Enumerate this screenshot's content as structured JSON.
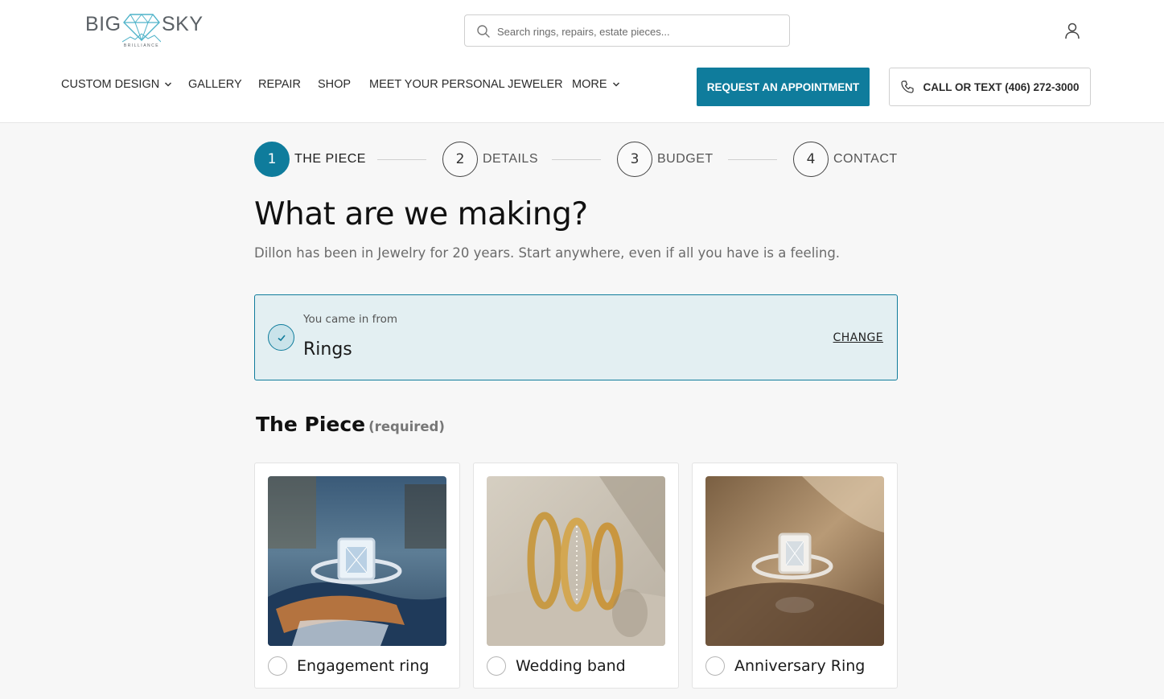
{
  "brand": {
    "left_word": "BIG",
    "right_word": "SKY",
    "tagline": "BRILLIANCE"
  },
  "search": {
    "placeholder": "Search rings, repairs, estate pieces..."
  },
  "nav": [
    {
      "label": "CUSTOM DESIGN",
      "has_dropdown": true
    },
    {
      "label": "GALLERY",
      "has_dropdown": false
    },
    {
      "label": "REPAIR",
      "has_dropdown": false
    },
    {
      "label": "SHOP",
      "has_dropdown": false
    },
    {
      "label": "MEET YOUR PERSONAL JEWELER",
      "has_dropdown": false
    },
    {
      "label": "MORE",
      "has_dropdown": true
    }
  ],
  "cta": {
    "appointment": "REQUEST AN APPOINTMENT",
    "call": "CALL OR TEXT (406) 272-3000"
  },
  "steps": [
    {
      "number": "1",
      "label": "THE PIECE",
      "active": true
    },
    {
      "number": "2",
      "label": "DETAILS",
      "active": false
    },
    {
      "number": "3",
      "label": "BUDGET",
      "active": false
    },
    {
      "number": "4",
      "label": "CONTACT",
      "active": false
    }
  ],
  "page": {
    "title": "What are we making?",
    "subtitle": "Dillon has been in Jewelry for 20 years. Start anywhere, even if all you have is a feeling."
  },
  "origin": {
    "label": "You came in from",
    "value": "Rings",
    "change": "CHANGE"
  },
  "section": {
    "title": "The Piece",
    "note": "(required)"
  },
  "options": [
    {
      "label": "Engagement ring",
      "selected": false
    },
    {
      "label": "Wedding band",
      "selected": false
    },
    {
      "label": "Anniversary Ring",
      "selected": false
    }
  ],
  "colors": {
    "accent": "#0f7c9c",
    "origin_bg": "#e3eff2",
    "page_bg": "#f7f7f7"
  }
}
